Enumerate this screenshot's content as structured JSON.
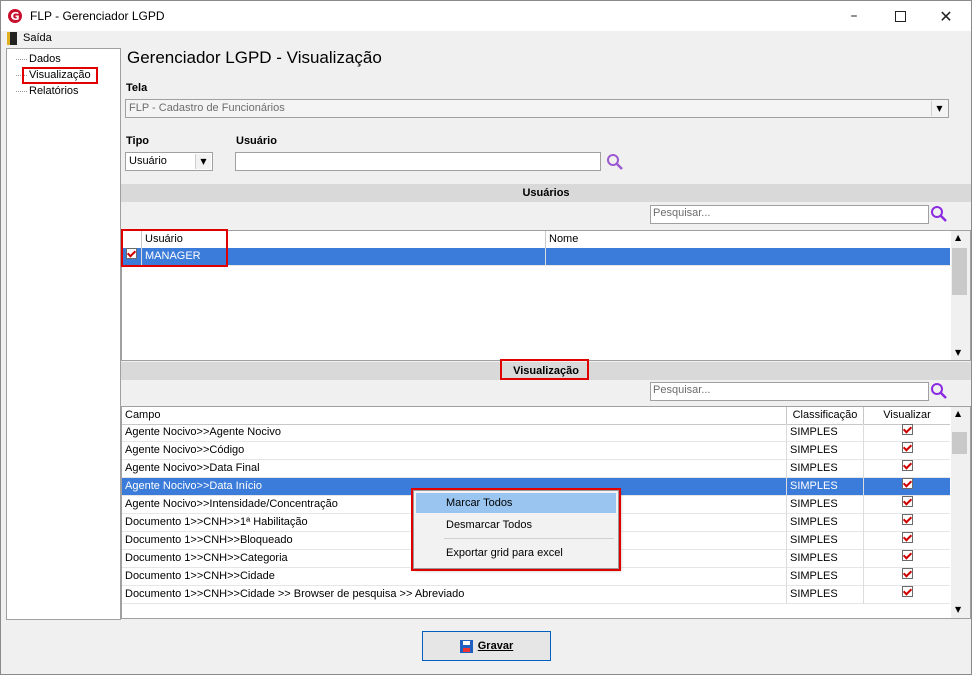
{
  "window": {
    "title": "FLP - Gerenciador LGPD"
  },
  "menu": {
    "exit_label": "Saída"
  },
  "tree": {
    "items": [
      "Dados",
      "Visualização",
      "Relatórios"
    ]
  },
  "page": {
    "title": "Gerenciador LGPD - Visualização"
  },
  "tela": {
    "label": "Tela",
    "value": "FLP - Cadastro de Funcionários"
  },
  "tipo": {
    "label": "Tipo",
    "value": "Usuário"
  },
  "usuario": {
    "label": "Usuário",
    "value": ""
  },
  "users_section": {
    "title": "Usuários",
    "search_placeholder": "Pesquisar...",
    "columns": [
      "Usuário",
      "Nome"
    ],
    "rows": [
      {
        "usuario": "MANAGER",
        "nome": "",
        "checked": true
      }
    ]
  },
  "view_section": {
    "title": "Visualização",
    "search_placeholder": "Pesquisar...",
    "columns": [
      "Campo",
      "Classificação",
      "Visualizar"
    ],
    "rows": [
      {
        "campo": "Agente Nocivo>>Agente Nocivo",
        "classificacao": "SIMPLES",
        "visualizar": true
      },
      {
        "campo": "Agente Nocivo>>Código",
        "classificacao": "SIMPLES",
        "visualizar": true
      },
      {
        "campo": "Agente Nocivo>>Data Final",
        "classificacao": "SIMPLES",
        "visualizar": true
      },
      {
        "campo": "Agente Nocivo>>Data Início",
        "classificacao": "SIMPLES",
        "visualizar": true
      },
      {
        "campo": "Agente Nocivo>>Intensidade/Concentração",
        "classificacao": "SIMPLES",
        "visualizar": true
      },
      {
        "campo": "Documento 1>>CNH>>1ª Habilitação",
        "classificacao": "SIMPLES",
        "visualizar": true
      },
      {
        "campo": "Documento 1>>CNH>>Bloqueado",
        "classificacao": "SIMPLES",
        "visualizar": true
      },
      {
        "campo": "Documento 1>>CNH>>Categoria",
        "classificacao": "SIMPLES",
        "visualizar": true
      },
      {
        "campo": "Documento 1>>CNH>>Cidade",
        "classificacao": "SIMPLES",
        "visualizar": true
      },
      {
        "campo": "Documento 1>>CNH>>Cidade >> Browser de pesquisa >> Abreviado",
        "classificacao": "SIMPLES",
        "visualizar": true
      }
    ]
  },
  "context_menu": {
    "items": [
      "Marcar Todos",
      "Desmarcar Todos",
      "Exportar grid para excel"
    ]
  },
  "save_button": {
    "label": "Gravar"
  },
  "colors": {
    "accent_red": "#e00000",
    "selection": "#3b7bd9",
    "search_icon": "#8a2be2"
  }
}
